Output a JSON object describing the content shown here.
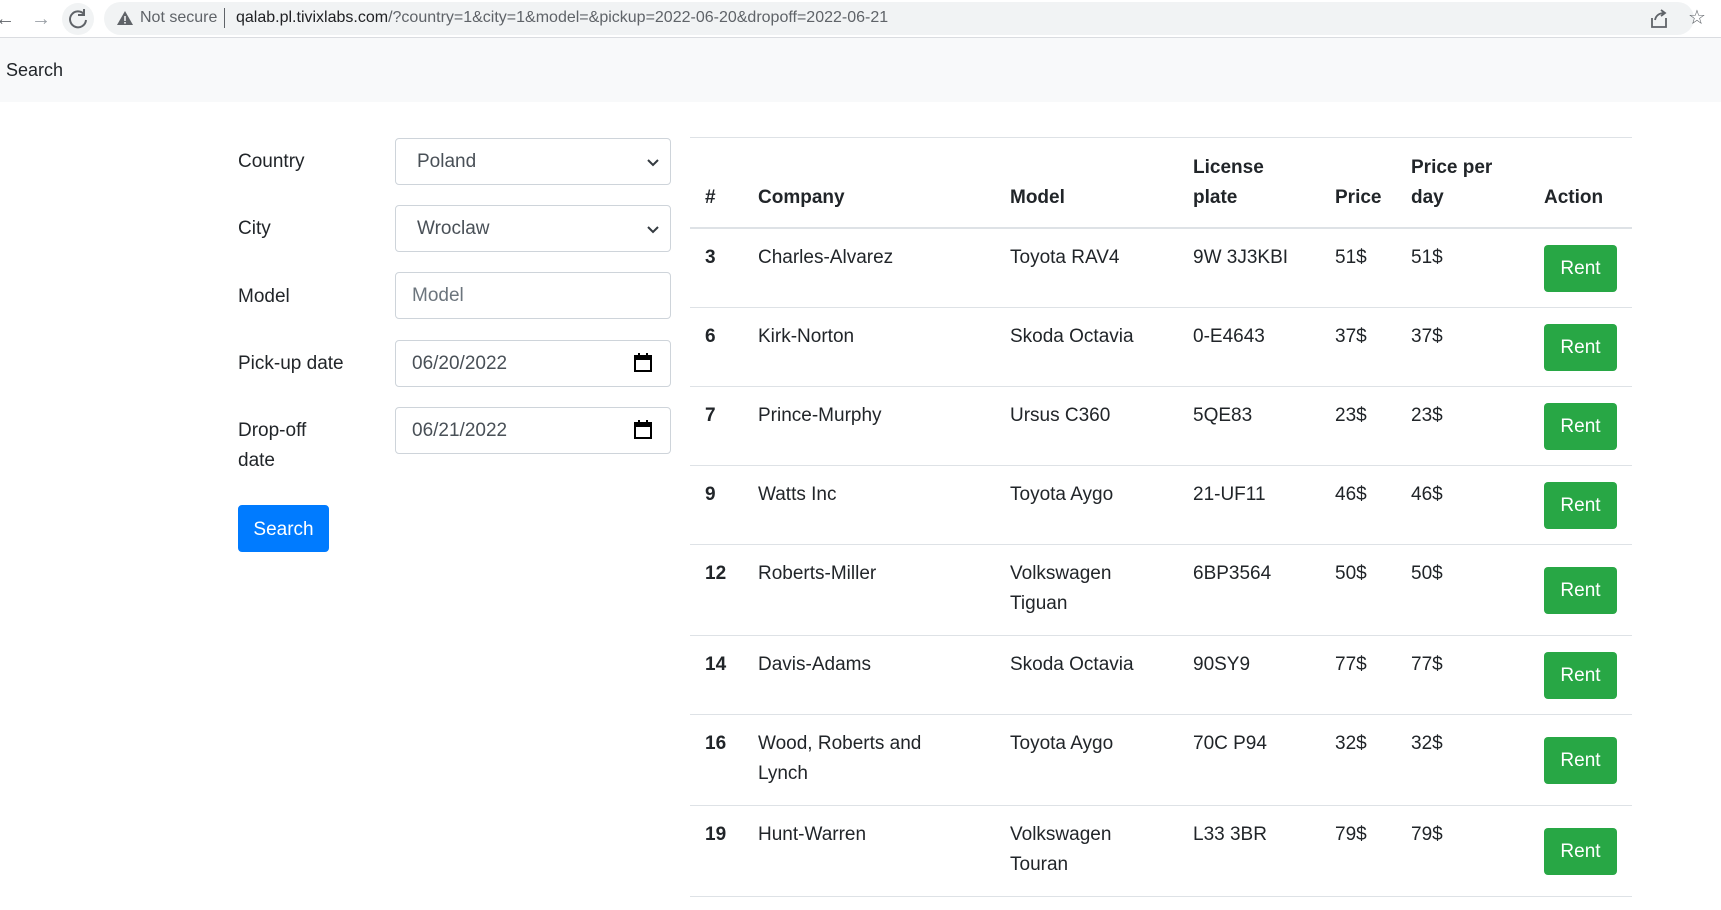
{
  "browser": {
    "not_secure": "Not secure",
    "url_host": "qalab.pl.tivixlabs.com",
    "url_rest": "/?country=1&city=1&model=&pickup=2022-06-20&dropoff=2022-06-21",
    "back_icon": "arrow-left-icon",
    "forward_icon": "arrow-right-icon",
    "reload_icon": "reload-icon"
  },
  "navbar": {
    "brand": "Search"
  },
  "form": {
    "country_label": "Country",
    "country_value": "Poland",
    "city_label": "City",
    "city_value": "Wroclaw",
    "model_label": "Model",
    "model_placeholder": "Model",
    "model_value": "",
    "pickup_label": "Pick-up date",
    "pickup_value": "06/20/2022",
    "dropoff_label_line1": "Drop-off",
    "dropoff_label_line2": "date",
    "dropoff_value": "06/21/2022",
    "search_button": "Search"
  },
  "table": {
    "headers": {
      "num": "#",
      "company": "Company",
      "model": "Model",
      "plate_line1": "License",
      "plate_line2": "plate",
      "price": "Price",
      "ppd_line1": "Price per",
      "ppd_line2": "day",
      "action": "Action"
    },
    "rent_label": "Rent",
    "rows": [
      {
        "num": "3",
        "company": [
          "Charles-Alvarez"
        ],
        "model": [
          "Toyota RAV4"
        ],
        "plate": "9W 3J3KBI",
        "price": "51$",
        "ppd": "51$"
      },
      {
        "num": "6",
        "company": [
          "Kirk-Norton"
        ],
        "model": [
          "Skoda Octavia"
        ],
        "plate": "0-E4643",
        "price": "37$",
        "ppd": "37$"
      },
      {
        "num": "7",
        "company": [
          "Prince-Murphy"
        ],
        "model": [
          "Ursus C360"
        ],
        "plate": "5QE83",
        "price": "23$",
        "ppd": "23$"
      },
      {
        "num": "9",
        "company": [
          "Watts Inc"
        ],
        "model": [
          "Toyota Aygo"
        ],
        "plate": "21-UF11",
        "price": "46$",
        "ppd": "46$"
      },
      {
        "num": "12",
        "company": [
          "Roberts-Miller"
        ],
        "model": [
          "Volkswagen",
          "Tiguan"
        ],
        "plate": "6BP3564",
        "price": "50$",
        "ppd": "50$"
      },
      {
        "num": "14",
        "company": [
          "Davis-Adams"
        ],
        "model": [
          "Skoda Octavia"
        ],
        "plate": "90SY9",
        "price": "77$",
        "ppd": "77$"
      },
      {
        "num": "16",
        "company": [
          "Wood, Roberts and",
          "Lynch"
        ],
        "model": [
          "Toyota Aygo"
        ],
        "plate": "70C P94",
        "price": "32$",
        "ppd": "32$"
      },
      {
        "num": "19",
        "company": [
          "Hunt-Warren"
        ],
        "model": [
          "Volkswagen",
          "Touran"
        ],
        "plate": "L33 3BR",
        "price": "79$",
        "ppd": "79$"
      }
    ]
  }
}
